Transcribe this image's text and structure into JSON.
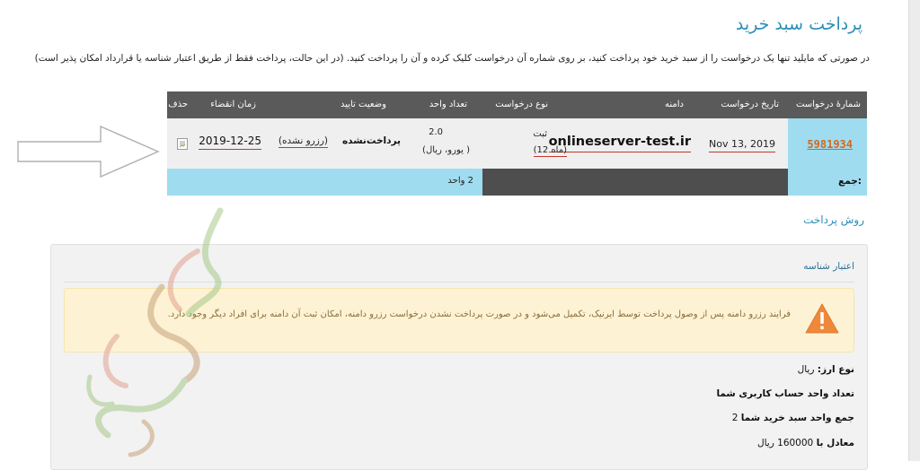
{
  "page": {
    "title": "پرداخت سبد خرید",
    "intro": "در صورتی که مایلید تنها یک درخواست را از سبد خرید خود پرداخت کنید، بر روی شماره آن درخواست کلیک کرده و آن را پرداخت کنید. (در این حالت، پرداخت فقط از طریق اعتبار شناسه یا قرارداد امکان پذیر است)"
  },
  "table": {
    "headers": {
      "request_number": "شمارۀ درخواست",
      "request_date": "تاریخ درخواست",
      "domain": "دامنه",
      "request_type": "نوع درخواست",
      "unit_count": "تعداد واحد",
      "approval_status": "وضعیت تایید",
      "expiry": "زمان انقضاء",
      "delete": "حذف"
    },
    "row": {
      "request_number": "5981934",
      "request_date": "Nov 13, 2019",
      "domain": "onlineserver-test.ir",
      "request_type": "ثبت",
      "duration": "(12 ماه)",
      "unit_count": "2.0",
      "unit_currency": "(یورو، ریال )",
      "status_bold": "پرداخت‌نشده",
      "status_note": "(رزرو نشده)",
      "expiry": "2019-12-25"
    },
    "sum": {
      "label": "جمع:",
      "value": "2 واحد"
    }
  },
  "payment": {
    "section_title": "روش پرداخت",
    "method_title": "اعتبار شناسه",
    "warning": "فرایند رزرو دامنه پس از وصول پرداخت توسط ایرنیک، تکمیل می‌شود و در صورت پرداخت نشدن درخواست رزرو دامنه، امکان ثبت آن دامنه برای افراد دیگر وجود دارد.",
    "currency_label": "نوع ارز:",
    "currency_value": "ریال",
    "account_units_label": "تعداد واحد حساب کاربری شما",
    "cart_units_label": "جمع واحد سبد خرید شما",
    "cart_units_value": "2",
    "equivalent_label": "معادل با",
    "equivalent_value": "160000 ریال"
  },
  "colors": {
    "accent": "#2a8fb9",
    "header_bg": "#5a5a5a",
    "highlight_cell": "#9fdcef",
    "id_link": "#d2691e",
    "warning_bg": "#fdf3d4",
    "warning_icon": "#f0883a"
  },
  "icons": {
    "arrow": "outline-arrow-right",
    "broken_image": "broken-image-icon",
    "warning": "warning-triangle-icon",
    "watermark": "watermark-logo"
  }
}
